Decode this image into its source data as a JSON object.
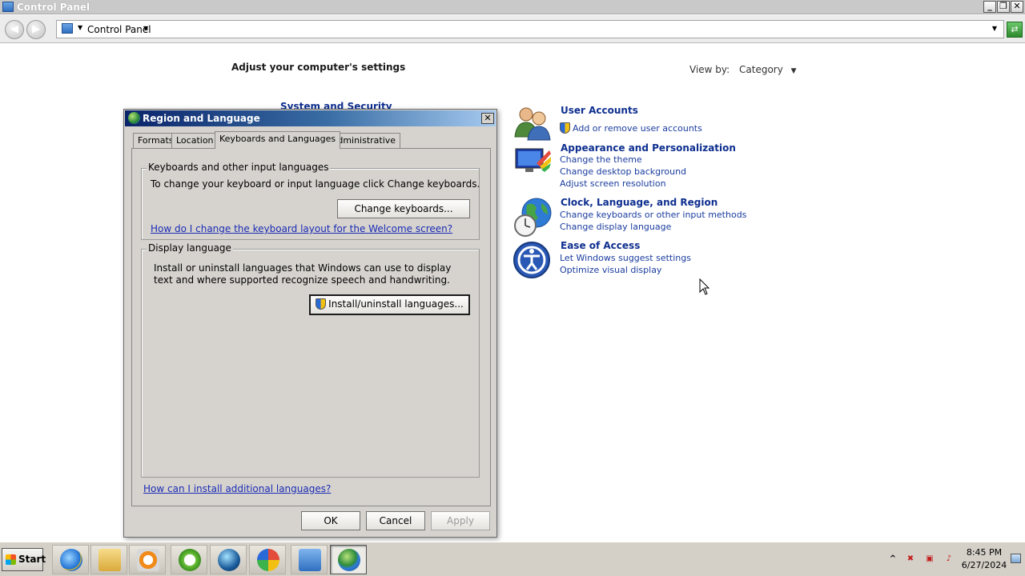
{
  "window": {
    "title": "Control Panel",
    "buttons": {
      "minimize": "_",
      "restore": "❐",
      "close": "✕"
    }
  },
  "address_bar": {
    "breadcrumb": "Control Panel"
  },
  "content": {
    "heading": "Adjust your computer's settings",
    "view_by_label": "View by:",
    "view_by_value": "Category",
    "hidden_category_title": "System and Security",
    "categories": [
      {
        "title": "User Accounts",
        "links": [
          "Add or remove user accounts"
        ]
      },
      {
        "title": "Appearance and Personalization",
        "links": [
          "Change the theme",
          "Change desktop background",
          "Adjust screen resolution"
        ]
      },
      {
        "title": "Clock, Language, and Region",
        "links": [
          "Change keyboards or other input methods",
          "Change display language"
        ]
      },
      {
        "title": "Ease of Access",
        "links": [
          "Let Windows suggest settings",
          "Optimize visual display"
        ]
      }
    ]
  },
  "dialog": {
    "title": "Region and Language",
    "close": "✕",
    "tabs": [
      "Formats",
      "Location",
      "Keyboards and Languages",
      "Administrative"
    ],
    "active_tab": "Keyboards and Languages",
    "keyboards_group": {
      "legend": "Keyboards and other input languages",
      "text": "To change your keyboard or input language click Change keyboards.",
      "button": "Change keyboards...",
      "link": "How do I change the keyboard layout for the Welcome screen?"
    },
    "display_group": {
      "legend": "Display language",
      "text": "Install or uninstall languages that Windows can use to display text and where supported recognize speech and handwriting.",
      "button": "Install/uninstall languages..."
    },
    "bottom_link": "How can I install additional languages?",
    "buttons": {
      "ok": "OK",
      "cancel": "Cancel",
      "apply": "Apply"
    }
  },
  "taskbar": {
    "start_label": "Start",
    "items": [
      "internet-explorer-icon",
      "windows-explorer-icon",
      "media-player-icon",
      "green-app-icon",
      "globe-app-icon",
      "paint-icon",
      "control-panel-icon",
      "region-language-icon"
    ],
    "active_item": "region-language-icon",
    "tray": {
      "show_hidden": "^",
      "time": "8:45 PM",
      "date": "6/27/2024"
    }
  }
}
